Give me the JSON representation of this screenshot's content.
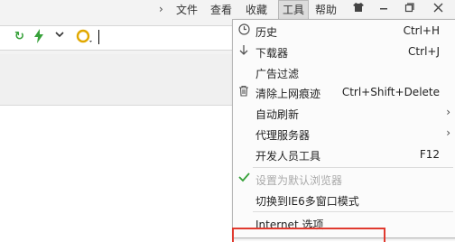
{
  "menubar": {
    "items": [
      "文件",
      "查看",
      "收藏",
      "工具",
      "帮助"
    ]
  },
  "tools_menu": {
    "items": [
      {
        "label": "历史",
        "shortcut": "Ctrl+H",
        "icon": "clock-icon"
      },
      {
        "label": "下载器",
        "shortcut": "Ctrl+J",
        "icon": "download-icon"
      },
      {
        "label": "广告过滤",
        "shortcut": "",
        "icon": ""
      },
      {
        "label": "清除上网痕迹",
        "shortcut": "Ctrl+Shift+Delete",
        "icon": "trash-icon"
      },
      {
        "label": "自动刷新",
        "shortcut": "",
        "icon": "",
        "submenu": true
      },
      {
        "label": "代理服务器",
        "shortcut": "",
        "icon": "",
        "submenu": true
      },
      {
        "label": "开发人员工具",
        "shortcut": "F12",
        "icon": ""
      },
      {
        "label": "设置为默认浏览器",
        "shortcut": "",
        "icon": "check-icon",
        "disabled": true
      },
      {
        "label": "切换到IE6多窗口模式",
        "shortcut": "",
        "icon": ""
      },
      {
        "label": "Internet 选项",
        "shortcut": "",
        "icon": ""
      }
    ]
  },
  "colors": {
    "accent_green": "#37a13a",
    "highlight_red": "#e03a2f"
  }
}
